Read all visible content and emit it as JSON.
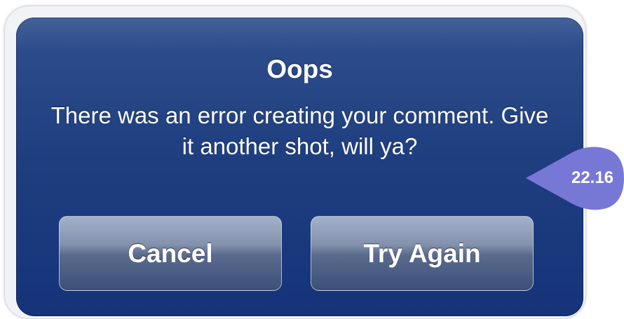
{
  "dialog": {
    "title": "Oops",
    "message": "There was an error creating your comment. Give it another shot, will ya?",
    "buttons": {
      "cancel_label": "Cancel",
      "retry_label": "Try Again"
    }
  },
  "badge": {
    "value": "22.16",
    "color": "#7778d6"
  },
  "colors": {
    "dialog_background": "#1f3f80",
    "dialog_border": "#f1f3f7",
    "button_top": "#a3b1c9",
    "button_bottom": "#3b4f78",
    "text": "#ffffff"
  }
}
